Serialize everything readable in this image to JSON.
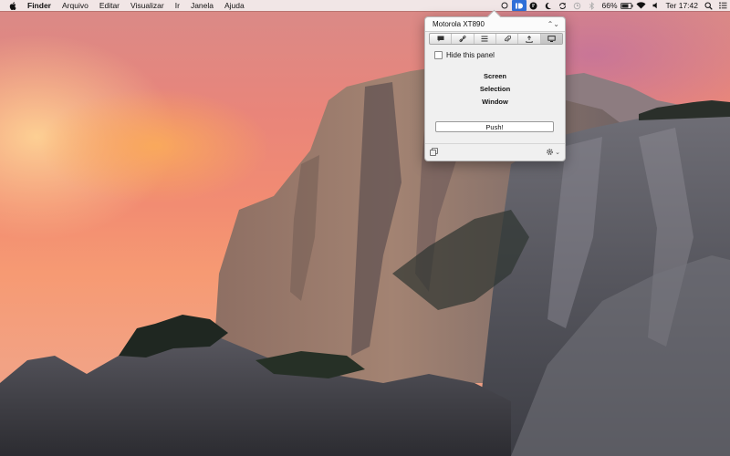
{
  "menubar": {
    "app_name": "Finder",
    "menus": [
      "Arquivo",
      "Editar",
      "Visualizar",
      "Ir",
      "Janela",
      "Ajuda"
    ],
    "status": {
      "battery_percent": "66%",
      "clock": "Ter 17:42"
    },
    "status_icons": [
      "circle-icon",
      "pushbullet-icon",
      "chat-icon",
      "crescent-icon",
      "sync-icon",
      "time-machine-icon",
      "bluetooth-icon",
      "battery-icon",
      "wifi-icon",
      "volume-icon",
      "search-icon",
      "list-icon"
    ]
  },
  "panel": {
    "device": "Motorola XT890",
    "tabs": [
      "note-icon",
      "link-icon",
      "list-icon",
      "attachment-icon",
      "upload-icon",
      "screen-icon"
    ],
    "selected_tab": "screen-icon",
    "hide_label": "Hide this panel",
    "hide_checked": false,
    "options": {
      "screen": "Screen",
      "selection": "Selection",
      "window": "Window"
    },
    "push_label": "Push!"
  },
  "colors": {
    "accent": "#2f6fd8",
    "sky_warm": "#f28c72",
    "rock": "#5e5c5f"
  }
}
